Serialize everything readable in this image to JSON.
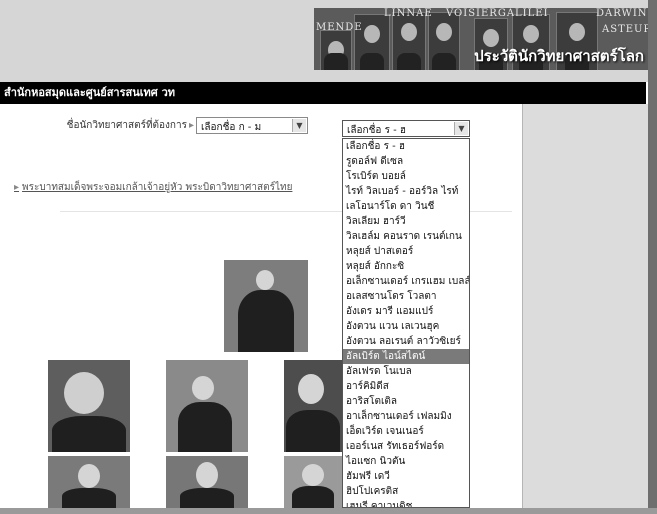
{
  "banner": {
    "names": [
      "LINNAE",
      "VOISIERGALILEI",
      "DARWIN",
      "MENDE",
      "ASTEUR"
    ],
    "tagline": "ประวัตินักวิทยาศาสตร์โลก"
  },
  "site_title": "สำนักหอสมุดและศูนย์สารสนเทศ วท",
  "filter": {
    "label": "ชื่อนักวิทยาศาสตร์ที่ต้องการ",
    "select1_value": "เลือกชื่อ ก - ม",
    "select2_value": "เลือกชื่อ ร - ฮ"
  },
  "dropdown_options": [
    "เลือกชื่อ ร - ฮ",
    "รูดอล์ฟ ดีเซล",
    "โรเบิร์ต บอยล์",
    "ไรท์ วิลเบอร์ - ออร์วิล ไรท์",
    "เลโอนาร์โด ดา วินชี",
    "วิลเลียม ฮาร์วี",
    "วิลเฮล์ม คอนราด เรนต์เกน",
    "หลุยส์ ปาสเตอร์",
    "หลุยส์ อักกะซิ",
    "อเล็กซานเดอร์ เกรแฮม เบลล์",
    "อเลสซานโดร โวลตา",
    "อังเดร มารี แอมแปร์",
    "อังตวน แวน เลเวนฮุค",
    "อังตวน ลอเรนต์ ลาวัวซิเยร์",
    "อัลเบิร์ต ไอน์สไตน์",
    "อัลเฟรด โนเบล",
    "อาร์คิมิดีส",
    "อาริสโตเติล",
    "อาเล็กซานเดอร์ เฟลมมิง",
    "เอ็ดเวิร์ด เจนเนอร์",
    "เออร์เนส รัทเธอร์ฟอร์ด",
    "ไอแซก นิวตัน",
    "ฮัมฟรี เดวี",
    "ฮิปโปเครติส",
    "เฮนรี คาเวนดิช"
  ],
  "selected_index": 14,
  "king_link": "พระบาทสมเด็จพระจอมเกล้าเจ้าอยู่หัว พระบิดาวิทยาศาสตร์ไทย"
}
